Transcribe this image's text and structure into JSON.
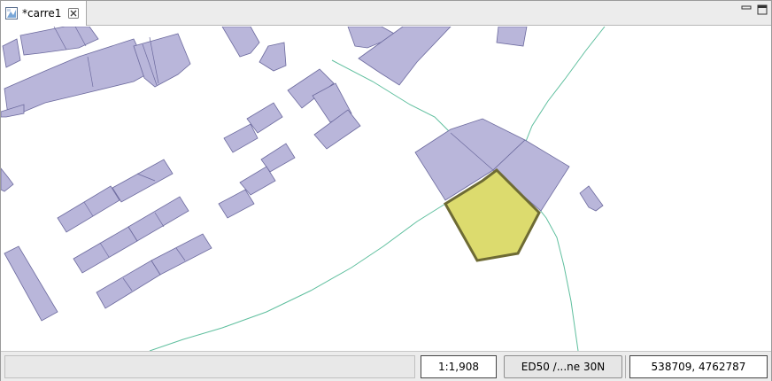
{
  "tab": {
    "title": "*carre1",
    "icon": "map-document-icon"
  },
  "view_controls": {
    "minimize_icon": "minimize-icon",
    "maximize_icon": "maximize-icon"
  },
  "map": {
    "building_fill": "#b9b6da",
    "building_stroke": "#6c6a9e",
    "selected_fill": "#dcdb6e",
    "selected_stroke": "#6e6b34",
    "line_color": "#5fbf9e"
  },
  "statusbar": {
    "message": "",
    "scale": "1:1,908",
    "crs": "ED50 /...ne 30N",
    "coordinates": "538709, 4762787"
  }
}
